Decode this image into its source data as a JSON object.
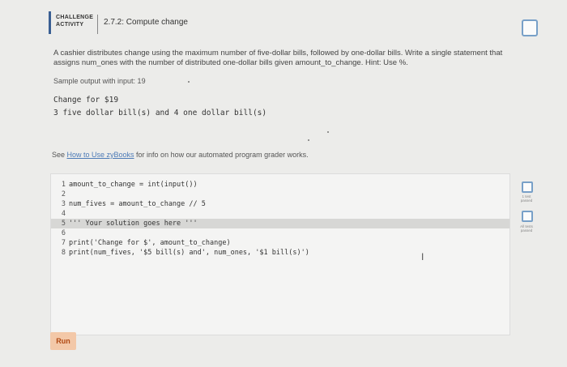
{
  "header": {
    "badge_line1": "CHALLENGE",
    "badge_line2": "ACTIVITY",
    "title": "2.7.2: Compute change"
  },
  "prompt": {
    "text": "A cashier distributes change using the maximum number of five-dollar bills, followed by one-dollar bills. Write a single statement that assigns num_ones with the number of distributed one-dollar bills given amount_to_change. Hint: Use %."
  },
  "sample": {
    "label": "Sample output with input: 19",
    "lines": [
      "Change for $19",
      "3 five dollar bill(s) and 4 one dollar bill(s)"
    ]
  },
  "info": {
    "prefix": "See ",
    "link": "How to Use zyBooks",
    "suffix": " for info on how our automated program grader works."
  },
  "editor": {
    "lines": [
      {
        "num": "1",
        "code": "amount_to_change = int(input())"
      },
      {
        "num": "2",
        "code": ""
      },
      {
        "num": "3",
        "code": "num_fives = amount_to_change // 5"
      },
      {
        "num": "4",
        "code": ""
      },
      {
        "num": "5",
        "code": "''' Your solution goes here '''"
      },
      {
        "num": "6",
        "code": ""
      },
      {
        "num": "7",
        "code": "print('Change for $', amount_to_change)"
      },
      {
        "num": "8",
        "code": "print(num_fives, '$5 bill(s) and', num_ones, '$1 bill(s)')"
      }
    ]
  },
  "run_button": "Run",
  "side": {
    "test1_label": "1 test passed",
    "test2_label": "All tests passed"
  }
}
